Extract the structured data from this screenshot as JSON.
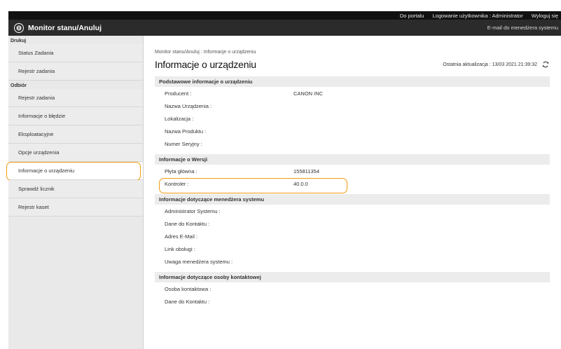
{
  "top_links": {
    "portal": "Do portalu",
    "user": "Logowanie użytkownika : Administrator",
    "logout": "Wyloguj się"
  },
  "header": {
    "title": "Monitor stanu/Anuluj",
    "manager_email": "E-mail do menedżera systemu",
    "logo_icon": "printer-globe-icon"
  },
  "sidebar": {
    "groups": [
      {
        "label": "Drukuj",
        "items": [
          "Status Zadania",
          "Rejestr zadania"
        ]
      },
      {
        "label": "Odbiór",
        "items": [
          "Rejestr zadania",
          "Informacje o błędzie",
          "Eksploatacyjne",
          "Opcje urządzenia",
          "Informacje o urządzeniu",
          "Sprawdź licznik",
          "Rejestr kaset"
        ]
      }
    ],
    "active": "Informacje o urządzeniu"
  },
  "main": {
    "breadcrumb": "Monitor stanu/Anuluj : Informacje o urządzeniu",
    "title": "Informacje o urządzeniu",
    "last_update": "Ostatnia aktualizacja : 13/03 2021 21:39:32",
    "sections": [
      {
        "header": "Podstawowe informacje o urządzeniu",
        "rows": [
          {
            "label": "Producent :",
            "value": "CANON INC"
          },
          {
            "label": "Nazwa Urządzenia :",
            "value": ""
          },
          {
            "label": "Lokalizacja :",
            "value": ""
          },
          {
            "label": "Nazwa Produktu :",
            "value": ""
          },
          {
            "label": "Numer Seryjny :",
            "value": ""
          }
        ]
      },
      {
        "header": "Informacje o Wersji",
        "rows": [
          {
            "label": "Płyta główna :",
            "value": "155811354"
          },
          {
            "label": "Kontroler :",
            "value": "40.0.0"
          }
        ]
      },
      {
        "header": "Informacje dotyczące menedżera systemu",
        "rows": [
          {
            "label": "Administrator Systemu :",
            "value": ""
          },
          {
            "label": "Dane do Kontaktu :",
            "value": ""
          },
          {
            "label": "Adres E-Mail :",
            "value": ""
          },
          {
            "label": "Link obsługi :",
            "value": ""
          },
          {
            "label": "Uwaga menedżera systemu :",
            "value": ""
          }
        ]
      },
      {
        "header": "Informacje dotyczące osoby kontaktowej",
        "rows": [
          {
            "label": "Osoba kontaktowa :",
            "value": ""
          },
          {
            "label": "Dane do Kontaktu :",
            "value": ""
          }
        ]
      }
    ]
  },
  "colors": {
    "highlight": "#f29b10",
    "header_bg": "#2b2b2b",
    "sidebar_bg": "#e9e9e9"
  }
}
